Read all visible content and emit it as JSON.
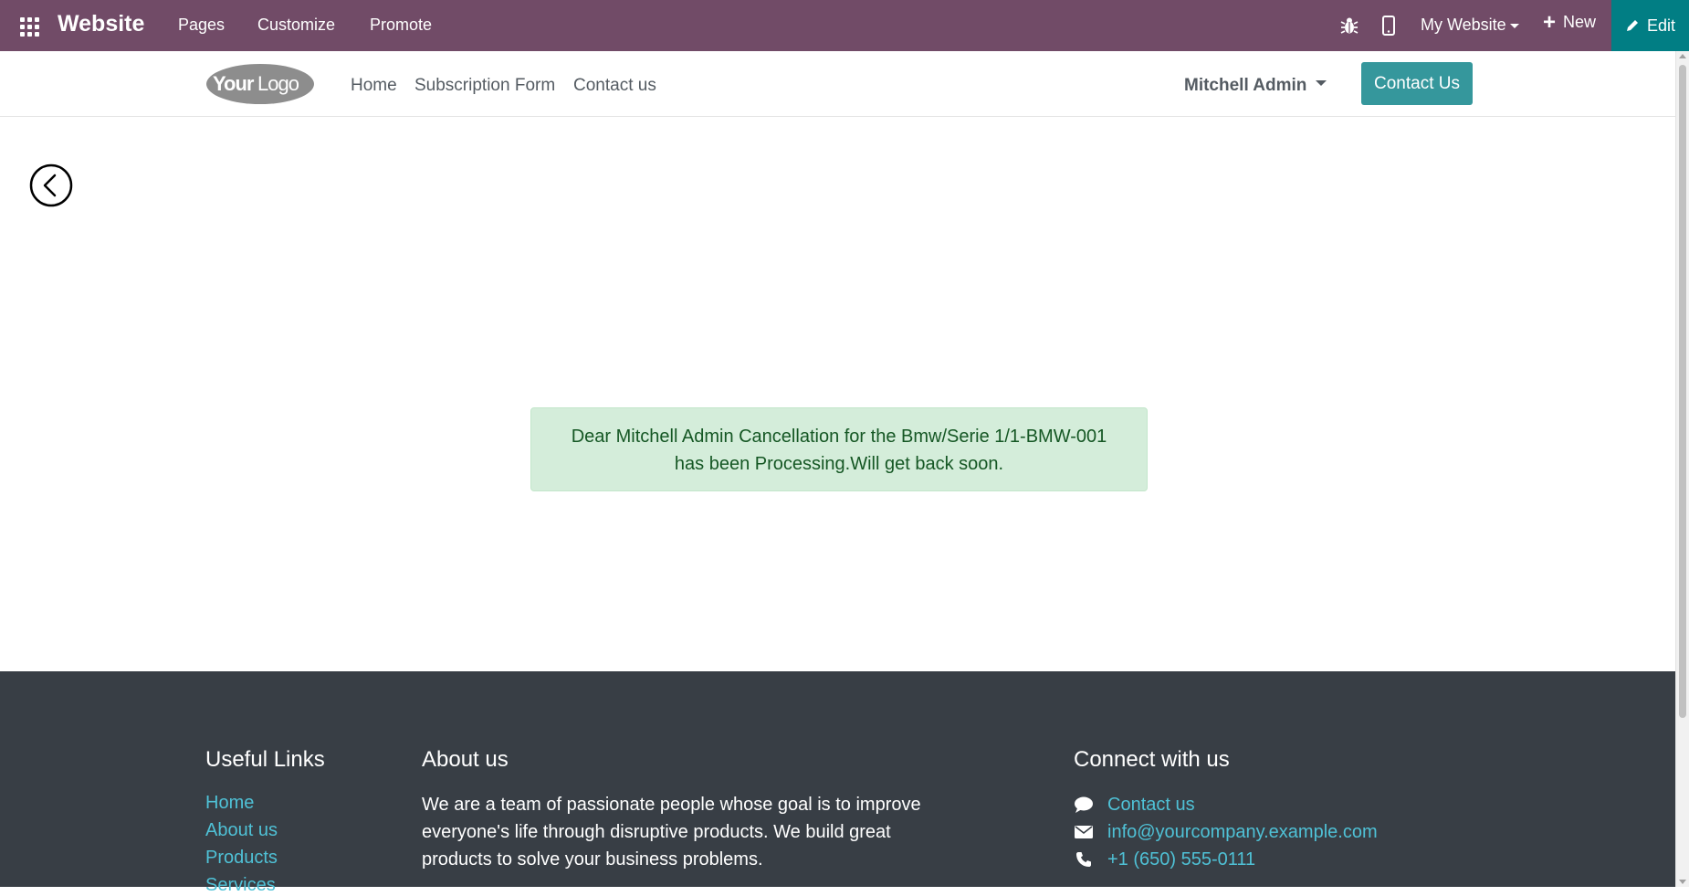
{
  "topbar": {
    "brand": "Website",
    "menu": [
      "Pages",
      "Customize",
      "Promote"
    ],
    "site_switcher": "My Website",
    "new_label": "New",
    "edit_label": "Edit",
    "colors": {
      "bar": "#714b67",
      "edit": "#017e84"
    }
  },
  "header": {
    "logo_text": "YourLogo",
    "nav": [
      "Home",
      "Subscription Form",
      "Contact us"
    ],
    "user": "Mitchell Admin",
    "cta": "Contact Us",
    "colors": {
      "cta": "#35979c"
    }
  },
  "main": {
    "message_line1": "Dear Mitchell Admin Cancellation for the Bmw/Serie 1/1-BMW-001",
    "message_line2": "has been Processing.Will get back soon."
  },
  "footer": {
    "useful_links_title": "Useful Links",
    "useful_links": [
      "Home",
      "About us",
      "Products",
      "Services"
    ],
    "about_title": "About us",
    "about_text": "We are a team of passionate people whose goal is to improve everyone's life through disruptive products. We build great products to solve your business problems.",
    "connect_title": "Connect with us",
    "connect": {
      "contact": "Contact us",
      "email": "info@yourcompany.example.com",
      "phone": "+1 (650) 555-0111"
    },
    "colors": {
      "background": "#383e45",
      "link": "#4fc1d6"
    }
  }
}
